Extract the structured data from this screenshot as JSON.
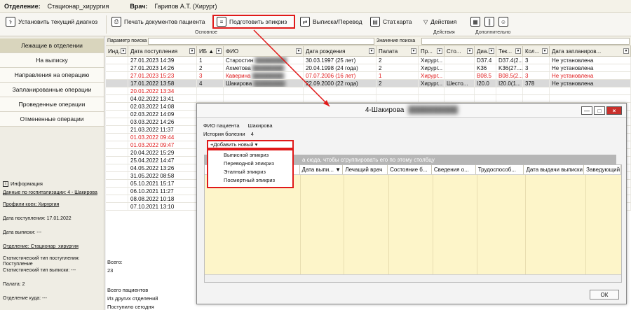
{
  "topbar": {
    "dept_label": "Отделение:",
    "dept_value": "Стационар_хирургия",
    "doctor_label": "Врач:",
    "doctor_value": "Гарипов А.Т. (Хирург)"
  },
  "toolbar": {
    "set_diagnosis": "Установить текущий диагноз",
    "print_docs": "Печать документов пациента",
    "prepare_epicrisis": "Подготовить эпикриз",
    "discharge": "Выписка/Перевод",
    "statcard": "Стат.карта",
    "actions": "Действия",
    "group_main": "Основное",
    "group_actions": "Действия",
    "group_extra": "Дополнительно"
  },
  "nav": {
    "items": [
      "Лежащие в отделении",
      "На выписку",
      "Направления на операцию",
      "Запланированные операции",
      "Проведенные операции",
      "Отмененные операции"
    ]
  },
  "info": {
    "title": "Информация",
    "hosp_data": "Данные по госпитализации: 4 - Шакирова",
    "bed_profile": "Профили коек: Хирургия",
    "admission": "Дата поступления: 17.01.2022",
    "discharge": "Дата выписки: ---",
    "department": "Отделение: Стационар_хирургия",
    "stat_type_in": "Статистический тип поступления: Поступление",
    "stat_type_out": "Статистический тип выписки: ---",
    "ward": "Палата: 2",
    "dept_to": "Отделение куда: ---"
  },
  "grid": {
    "search_param_label": "Параметр поиска",
    "search_value_label": "Значение поиска",
    "columns": [
      "Инд...",
      "Дата поступления",
      "ИБ ▲",
      "ФИО",
      "Дата рождения",
      "Палата",
      "Пр...",
      "Сто...",
      "Диа...",
      "Тек...",
      "Кол...",
      "Дата запланиров..."
    ],
    "rows": [
      {
        "date": "27.01.2023 14:39",
        "ib": "1",
        "fio": "Старостин",
        "dob": "30.03.1997 (25 лет)",
        "ward": "2",
        "pr": "Хирург...",
        "sto": "",
        "dia": "D37.4",
        "tek": "D37.4(2...",
        "kol": "3",
        "planned": "Не установлена",
        "style": ""
      },
      {
        "date": "27.01.2023 14:26",
        "ib": "2",
        "fio": "Ахметова",
        "dob": "20.04.1998 (24 года)",
        "ward": "2",
        "pr": "Хирург...",
        "sto": "",
        "dia": "K36",
        "tek": "K36(27....",
        "kol": "3",
        "planned": "Не установлена",
        "style": ""
      },
      {
        "date": "27.01.2023 15:23",
        "ib": "3",
        "fio": "Каверина",
        "dob": "07.07.2006 (16 лет)",
        "ward": "1",
        "pr": "Хирург...",
        "sto": "",
        "dia": "B08.5",
        "tek": "B08.5(2...",
        "kol": "3",
        "planned": "Не установлена",
        "style": "red"
      },
      {
        "date": "17.01.2022 13:58",
        "ib": "4",
        "fio": "Шакирова",
        "dob": "22.09.2000 (22 года)",
        "ward": "2",
        "pr": "Хирург...",
        "sto": "Шесто...",
        "dia": "I20.0",
        "tek": "I20.0(1...",
        "kol": "378",
        "planned": "Не установлена",
        "style": "sel"
      },
      {
        "date": "20.01.2022 13:34",
        "style": "red"
      },
      {
        "date": "04.02.2022 13:41",
        "style": ""
      },
      {
        "date": "02.03.2022 14:08",
        "style": ""
      },
      {
        "date": "02.03.2022 14:09",
        "style": ""
      },
      {
        "date": "03.03.2022 14:26",
        "style": ""
      },
      {
        "date": "21.03.2022 11:37",
        "style": ""
      },
      {
        "date": "01.03.2022 09:44",
        "style": "red"
      },
      {
        "date": "01.03.2022 09:47",
        "style": "red"
      },
      {
        "date": "20.04.2022 15:29",
        "style": ""
      },
      {
        "date": "25.04.2022 14:47",
        "style": ""
      },
      {
        "date": "04.05.2022 13:26",
        "style": ""
      },
      {
        "date": "31.05.2022 08:58",
        "style": ""
      },
      {
        "date": "05.10.2021 15:17",
        "style": ""
      },
      {
        "date": "06.10.2021 11:27",
        "style": ""
      },
      {
        "date": "08.08.2022 10:18",
        "style": ""
      },
      {
        "date": "07.10.2021 13:10",
        "style": ""
      }
    ],
    "total_label": "Всего:",
    "total_value": "23",
    "all_patients": "Всего пациентов",
    "from_other": "Из других отделений",
    "admitted": "Поступило сегодня"
  },
  "dialog": {
    "title": "4-Шакирова",
    "fio_label": "ФИО пациента",
    "fio_value": "Шакирова",
    "history_label": "История болезни",
    "history_value": "4",
    "add_new": "+Добавить новый ▾",
    "menu": [
      "Выписной эпикриз",
      "Переводной эпикриз",
      "Этапный эпикриз",
      "Посмертный эпикриз"
    ],
    "group_hint": "а сюда, чтобы сгруппировать его по этому столбцу",
    "columns": [
      "Дата выпи... ▼",
      "Лечащий врач",
      "Состояние б...",
      "Сведения о...",
      "Трудоспособ...",
      "Дата выдачи выписки",
      "Заведующий"
    ],
    "ok": "ОК"
  },
  "colors": {
    "highlight": "#e01919",
    "selected_row": "#d9d9d9",
    "dialog_grid": "#fdf5c9"
  }
}
